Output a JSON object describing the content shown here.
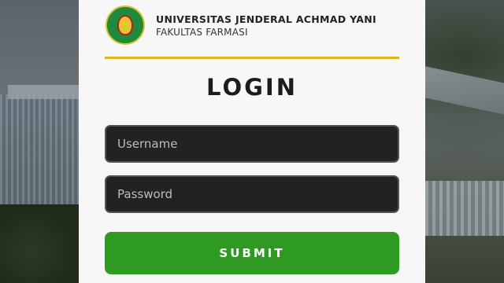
{
  "brand": {
    "logo_icon": "university-seal-icon",
    "university_name": "UNIVERSITAS JENDERAL ACHMAD YANI",
    "faculty": "FAKULTAS FARMASI"
  },
  "form": {
    "title": "LOGIN",
    "username_placeholder": "Username",
    "password_placeholder": "Password",
    "submit_label": "SUBMIT"
  },
  "colors": {
    "accent_line": "#e2b41b",
    "submit_bg": "#2f9a22",
    "input_bg": "#222222"
  }
}
